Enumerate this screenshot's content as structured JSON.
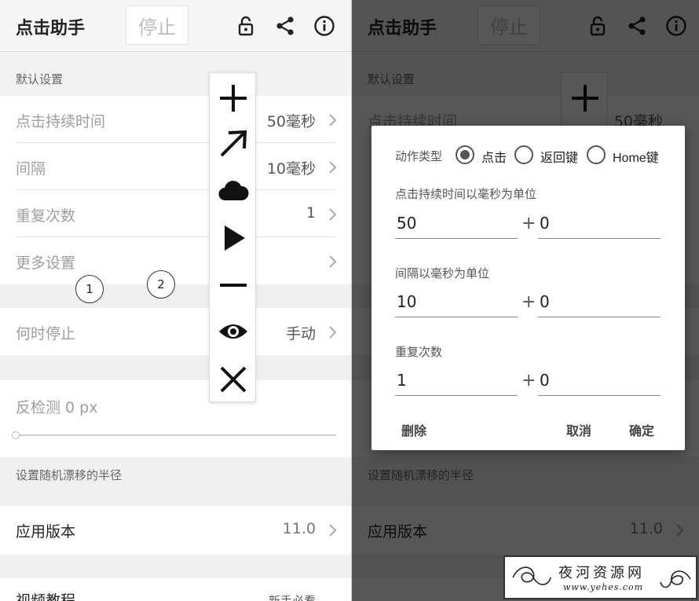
{
  "app": {
    "title": "点击助手",
    "stop_label": "停止"
  },
  "settings": {
    "default_header": "默认设置",
    "rows": [
      {
        "label": "点击持续时间",
        "value": "50毫秒"
      },
      {
        "label": "间隔",
        "value": "10毫秒"
      },
      {
        "label": "重复次数",
        "value": "1"
      },
      {
        "label": "更多设置",
        "value": ""
      }
    ],
    "when_stop": {
      "label": "何时停止",
      "value": "手动"
    },
    "anti_detect": {
      "label": "反检测 0 px",
      "slider_fraction": 0
    },
    "drift_header": "设置随机漂移的半径",
    "app_version": {
      "label": "应用版本",
      "value": "11.0"
    },
    "video": {
      "label": "视频教程",
      "value": "新手必看"
    }
  },
  "badges": [
    "1",
    "2"
  ],
  "toolbar": {
    "icons": [
      "plus-icon",
      "arrow-icon",
      "cloud-icon",
      "play-icon",
      "minus-icon",
      "eye-icon",
      "close-icon"
    ]
  },
  "dialog": {
    "action_type_label": "动作类型",
    "radio_options": [
      {
        "label": "点击",
        "selected": true
      },
      {
        "label": "返回键",
        "selected": false
      },
      {
        "label": "Home键",
        "selected": false
      }
    ],
    "duration_label": "点击持续时间以毫秒为单位",
    "duration_value": "50",
    "duration_extra": "0",
    "interval_label": "间隔以毫秒为单位",
    "interval_value": "10",
    "interval_extra": "0",
    "repeat_label": "重复次数",
    "repeat_value": "1",
    "repeat_extra": "0",
    "delete_label": "删除",
    "cancel_label": "取消",
    "ok_label": "确定"
  },
  "watermark": {
    "text": "夜河资源网",
    "url": "www.yehes.com"
  }
}
